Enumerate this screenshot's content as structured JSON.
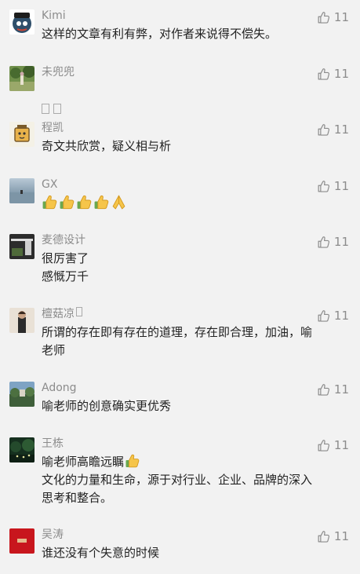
{
  "comments": [
    {
      "name": "Kimi",
      "likes": "11",
      "text": "这样的文章有利有弊，对作者来说得不偿失。"
    },
    {
      "name": "未兜兜",
      "likes": "11",
      "text": ""
    },
    {
      "name": "程凯",
      "likes": "11",
      "text": "奇文共欣赏，疑义相与析"
    },
    {
      "name": "GX",
      "likes": "11",
      "text": ""
    },
    {
      "name": "麦德设计",
      "likes": "11",
      "text": "很厉害了\n感慨万千"
    },
    {
      "name": "檀菇凉",
      "likes": "11",
      "text": "所谓的存在即有存在的道理，存在即合理，加油，喻\n老师"
    },
    {
      "name": "Adong",
      "likes": "11",
      "text": "喻老师的创意确实更优秀"
    },
    {
      "name": "王栋",
      "likes": "11",
      "text_line1": "喻老师高瞻远瞩",
      "text_rest": "文化的力量和生命，源于对行业、企业、品牌的深入\n思考和整合。"
    },
    {
      "name": "吴涛",
      "likes": "11",
      "text": "谁还没有个失意的时候"
    }
  ],
  "icons": {
    "like": "thumbs-up-outline-icon",
    "emoji_thumb": "thumbs-up-emoji",
    "emoji_hands": "folded-hands-emoji"
  },
  "colors": {
    "background": "#f2f2f2",
    "name": "#8c8c8c",
    "text": "#222222"
  }
}
